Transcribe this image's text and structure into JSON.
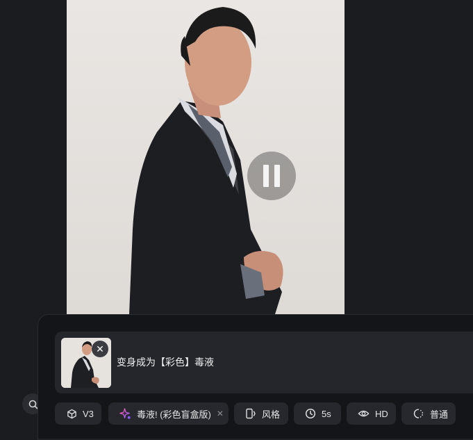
{
  "prompt": {
    "text": "变身成为【彩色】毒液",
    "remove_label": "✕"
  },
  "toolbar": {
    "model": "V3",
    "effect": "毒液! (彩色盲盒版)",
    "effect_remove": "✕",
    "style": "风格",
    "duration": "5s",
    "quality": "HD",
    "mode": "普通"
  },
  "icons": {
    "model": "cube-icon",
    "effect": "sparkle-icon",
    "style": "aspect-ratio-icon",
    "duration": "clock-icon",
    "quality": "eye-icon",
    "mode": "speed-icon",
    "video": "pause-icon",
    "search": "search-icon"
  },
  "colors": {
    "background": "#1b1c20",
    "panel": "#141518",
    "card": "#24262b",
    "chip": "#26282d",
    "sparkle_start": "#ff5aa0",
    "sparkle_end": "#8a5cff"
  }
}
